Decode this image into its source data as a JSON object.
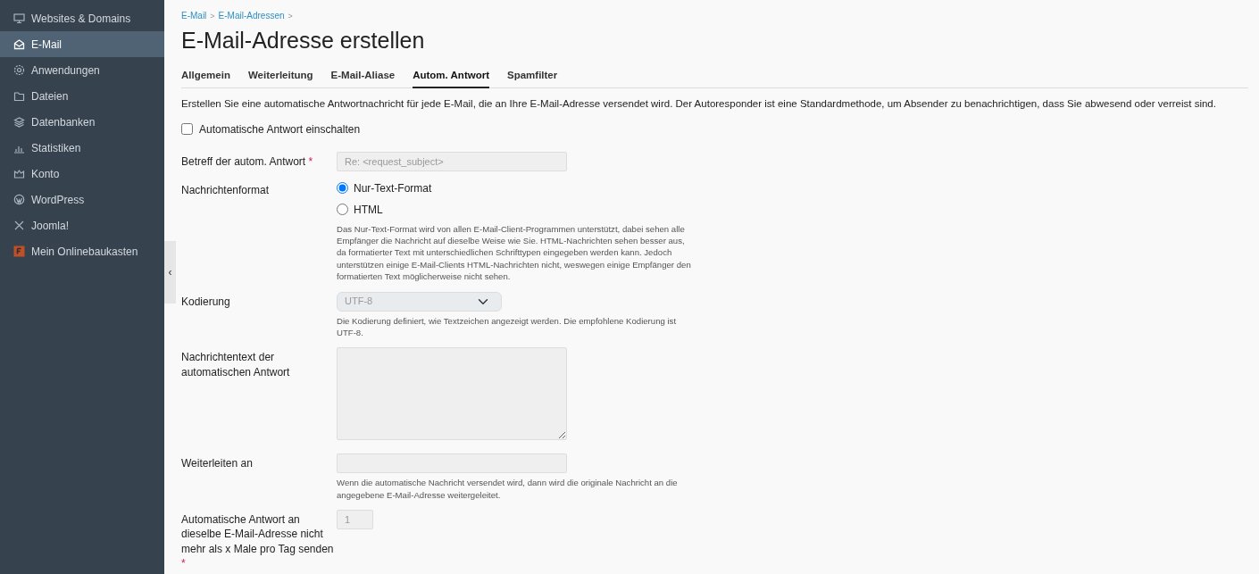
{
  "sidebar": {
    "items": [
      {
        "label": "Websites & Domains",
        "selected": false
      },
      {
        "label": "E-Mail",
        "selected": true
      },
      {
        "label": "Anwendungen",
        "selected": false
      },
      {
        "label": "Dateien",
        "selected": false
      },
      {
        "label": "Datenbanken",
        "selected": false
      },
      {
        "label": "Statistiken",
        "selected": false
      },
      {
        "label": "Konto",
        "selected": false
      },
      {
        "label": "WordPress",
        "selected": false
      },
      {
        "label": "Joomla!",
        "selected": false
      },
      {
        "label": "Mein Onlinebaukasten",
        "selected": false
      }
    ],
    "collapse_handle": "‹"
  },
  "breadcrumb": [
    {
      "label": "E-Mail"
    },
    {
      "label": "E-Mail-Adressen"
    }
  ],
  "breadcrumb_separator": ">",
  "page_title": "E-Mail-Adresse erstellen",
  "tabs": [
    {
      "label": "Allgemein",
      "selected": false
    },
    {
      "label": "Weiterleitung",
      "selected": false
    },
    {
      "label": "E-Mail-Aliase",
      "selected": false
    },
    {
      "label": "Autom. Antwort",
      "selected": true
    },
    {
      "label": "Spamfilter",
      "selected": false
    }
  ],
  "intro": "Erstellen Sie eine automatische Antwortnachricht für jede E-Mail, die an Ihre E-Mail-Adresse versendet wird. Der Autoresponder ist eine Standardmethode, um Absender zu benachrichtigen, dass Sie abwesend oder verreist sind.",
  "enable_checkbox": {
    "label": "Automatische Antwort einschalten",
    "checked": false
  },
  "fields": [
    {
      "kind": "text",
      "label": "Betreff der autom. Antwort",
      "required_mark": "*",
      "placeholder": "Re: <request_subject>",
      "disabled": true
    },
    {
      "kind": "radio",
      "label": "Nachrichtenformat",
      "options": [
        {
          "label": "Nur-Text-Format",
          "selected": true
        },
        {
          "label": "HTML",
          "selected": false
        }
      ],
      "help": "Das Nur-Text-Format wird von allen E-Mail-Client-Programmen unterstützt, dabei sehen alle Empfänger die Nachricht auf dieselbe Weise wie Sie. HTML-Nachrichten sehen besser aus, da formatierter Text mit unterschiedlichen Schrifttypen eingegeben werden kann. Jedoch unterstützen einige E-Mail-Clients HTML-Nachrichten nicht, weswegen einige Empfänger den formatierten Text möglicherweise nicht sehen."
    },
    {
      "kind": "select",
      "label": "Kodierung",
      "value": "UTF-8",
      "disabled": true,
      "help": "Die Kodierung definiert, wie Textzeichen angezeigt werden. Die empfohlene Kodierung ist UTF-8."
    },
    {
      "kind": "textarea",
      "label": "Nachrichtentext der automatischen Antwort",
      "disabled": true
    },
    {
      "kind": "text",
      "label": "Weiterleiten an",
      "disabled": true,
      "help": "Wenn die automatische Nachricht versendet wird, dann wird die originale Nachricht an die angegebene E-Mail-Adresse weitergeleitet."
    },
    {
      "kind": "number",
      "label": "Automatische Antwort an dieselbe E-Mail-Adresse nicht mehr als x Male pro Tag senden",
      "required_mark": "*",
      "value": "1",
      "disabled": true
    }
  ]
}
